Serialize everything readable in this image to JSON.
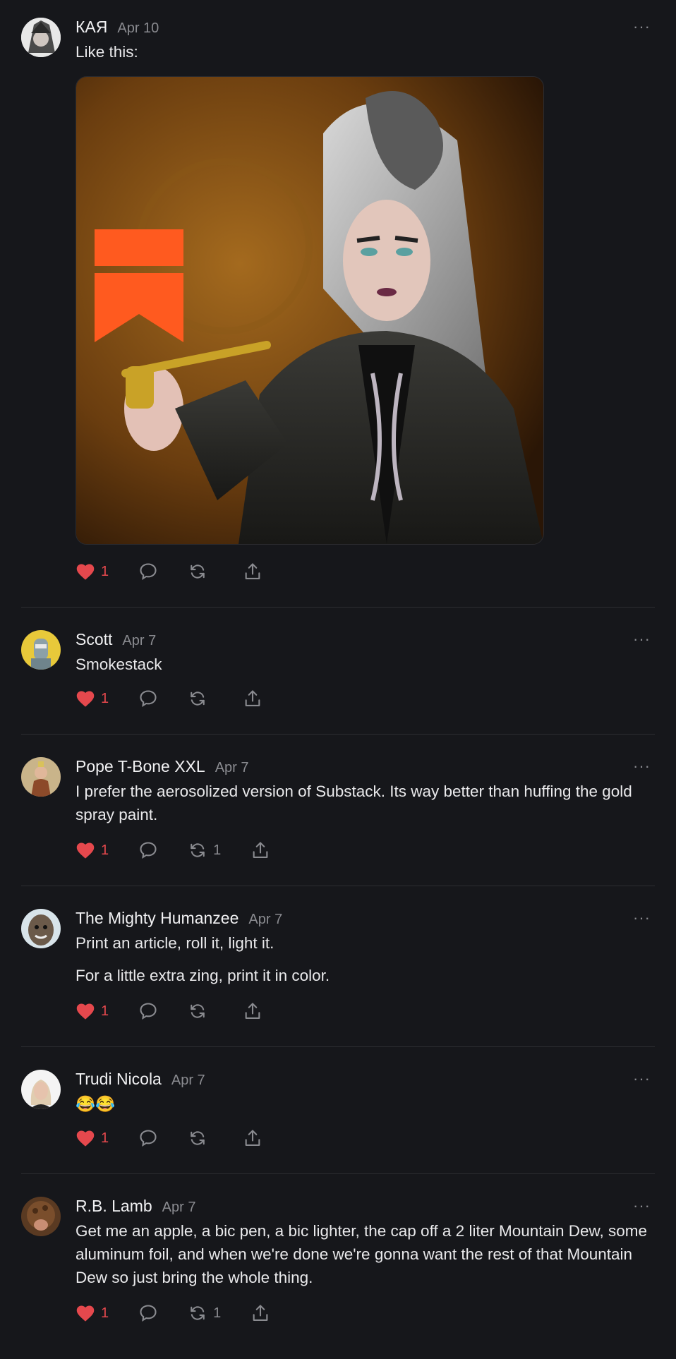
{
  "posts": [
    {
      "author": "КАЯ",
      "date": "Apr 10",
      "paragraphs": [
        "Like this:"
      ],
      "has_image": true,
      "likes": "1",
      "restacks": ""
    },
    {
      "author": "Scott",
      "date": "Apr 7",
      "paragraphs": [
        "Smokestack"
      ],
      "likes": "1",
      "restacks": ""
    },
    {
      "author": "Pope T-Bone XXL",
      "date": "Apr 7",
      "paragraphs": [
        "I prefer the aerosolized version of Substack. Its way better than huffing the gold spray paint."
      ],
      "likes": "1",
      "restacks": "1"
    },
    {
      "author": "The Mighty Humanzee",
      "date": "Apr 7",
      "paragraphs": [
        "Print an article, roll it, light it.",
        "For a little extra zing, print it in color."
      ],
      "likes": "1",
      "restacks": ""
    },
    {
      "author": "Trudi Nicola",
      "date": "Apr 7",
      "paragraphs": [
        "😂😂"
      ],
      "likes": "1",
      "restacks": ""
    },
    {
      "author": "R.B. Lamb",
      "date": "Apr 7",
      "paragraphs": [
        "Get me an apple, a bic pen, a bic lighter, the cap off a 2 liter Mountain Dew, some aluminum foil, and when we're done we're gonna want the rest of that Mountain Dew so just bring the whole thing."
      ],
      "likes": "1",
      "restacks": "1"
    }
  ],
  "more_glyph": "···",
  "colors": {
    "background": "#16171b",
    "like": "#e5484d",
    "muted": "#8a8b90",
    "substack_orange": "#ff5a1f"
  },
  "icons": [
    "heart-icon",
    "comment-icon",
    "restack-icon",
    "share-icon",
    "more-icon"
  ]
}
